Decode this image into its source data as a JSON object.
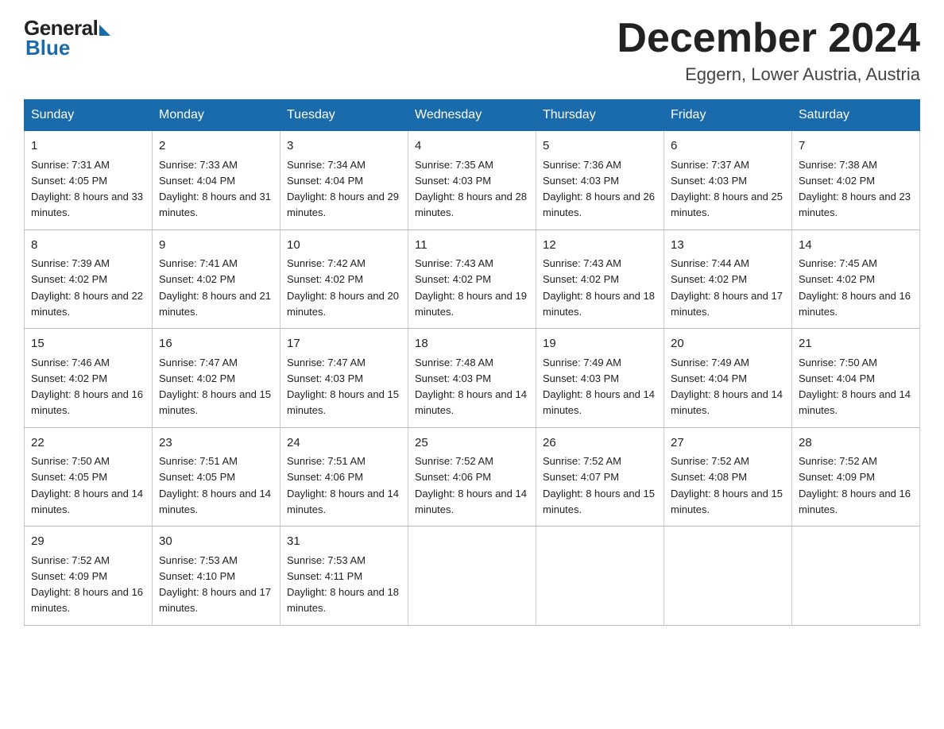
{
  "header": {
    "logo_general": "General",
    "logo_blue": "Blue",
    "month_title": "December 2024",
    "location": "Eggern, Lower Austria, Austria"
  },
  "weekdays": [
    "Sunday",
    "Monday",
    "Tuesday",
    "Wednesday",
    "Thursday",
    "Friday",
    "Saturday"
  ],
  "weeks": [
    [
      {
        "day": "1",
        "sunrise": "7:31 AM",
        "sunset": "4:05 PM",
        "daylight": "8 hours and 33 minutes."
      },
      {
        "day": "2",
        "sunrise": "7:33 AM",
        "sunset": "4:04 PM",
        "daylight": "8 hours and 31 minutes."
      },
      {
        "day": "3",
        "sunrise": "7:34 AM",
        "sunset": "4:04 PM",
        "daylight": "8 hours and 29 minutes."
      },
      {
        "day": "4",
        "sunrise": "7:35 AM",
        "sunset": "4:03 PM",
        "daylight": "8 hours and 28 minutes."
      },
      {
        "day": "5",
        "sunrise": "7:36 AM",
        "sunset": "4:03 PM",
        "daylight": "8 hours and 26 minutes."
      },
      {
        "day": "6",
        "sunrise": "7:37 AM",
        "sunset": "4:03 PM",
        "daylight": "8 hours and 25 minutes."
      },
      {
        "day": "7",
        "sunrise": "7:38 AM",
        "sunset": "4:02 PM",
        "daylight": "8 hours and 23 minutes."
      }
    ],
    [
      {
        "day": "8",
        "sunrise": "7:39 AM",
        "sunset": "4:02 PM",
        "daylight": "8 hours and 22 minutes."
      },
      {
        "day": "9",
        "sunrise": "7:41 AM",
        "sunset": "4:02 PM",
        "daylight": "8 hours and 21 minutes."
      },
      {
        "day": "10",
        "sunrise": "7:42 AM",
        "sunset": "4:02 PM",
        "daylight": "8 hours and 20 minutes."
      },
      {
        "day": "11",
        "sunrise": "7:43 AM",
        "sunset": "4:02 PM",
        "daylight": "8 hours and 19 minutes."
      },
      {
        "day": "12",
        "sunrise": "7:43 AM",
        "sunset": "4:02 PM",
        "daylight": "8 hours and 18 minutes."
      },
      {
        "day": "13",
        "sunrise": "7:44 AM",
        "sunset": "4:02 PM",
        "daylight": "8 hours and 17 minutes."
      },
      {
        "day": "14",
        "sunrise": "7:45 AM",
        "sunset": "4:02 PM",
        "daylight": "8 hours and 16 minutes."
      }
    ],
    [
      {
        "day": "15",
        "sunrise": "7:46 AM",
        "sunset": "4:02 PM",
        "daylight": "8 hours and 16 minutes."
      },
      {
        "day": "16",
        "sunrise": "7:47 AM",
        "sunset": "4:02 PM",
        "daylight": "8 hours and 15 minutes."
      },
      {
        "day": "17",
        "sunrise": "7:47 AM",
        "sunset": "4:03 PM",
        "daylight": "8 hours and 15 minutes."
      },
      {
        "day": "18",
        "sunrise": "7:48 AM",
        "sunset": "4:03 PM",
        "daylight": "8 hours and 14 minutes."
      },
      {
        "day": "19",
        "sunrise": "7:49 AM",
        "sunset": "4:03 PM",
        "daylight": "8 hours and 14 minutes."
      },
      {
        "day": "20",
        "sunrise": "7:49 AM",
        "sunset": "4:04 PM",
        "daylight": "8 hours and 14 minutes."
      },
      {
        "day": "21",
        "sunrise": "7:50 AM",
        "sunset": "4:04 PM",
        "daylight": "8 hours and 14 minutes."
      }
    ],
    [
      {
        "day": "22",
        "sunrise": "7:50 AM",
        "sunset": "4:05 PM",
        "daylight": "8 hours and 14 minutes."
      },
      {
        "day": "23",
        "sunrise": "7:51 AM",
        "sunset": "4:05 PM",
        "daylight": "8 hours and 14 minutes."
      },
      {
        "day": "24",
        "sunrise": "7:51 AM",
        "sunset": "4:06 PM",
        "daylight": "8 hours and 14 minutes."
      },
      {
        "day": "25",
        "sunrise": "7:52 AM",
        "sunset": "4:06 PM",
        "daylight": "8 hours and 14 minutes."
      },
      {
        "day": "26",
        "sunrise": "7:52 AM",
        "sunset": "4:07 PM",
        "daylight": "8 hours and 15 minutes."
      },
      {
        "day": "27",
        "sunrise": "7:52 AM",
        "sunset": "4:08 PM",
        "daylight": "8 hours and 15 minutes."
      },
      {
        "day": "28",
        "sunrise": "7:52 AM",
        "sunset": "4:09 PM",
        "daylight": "8 hours and 16 minutes."
      }
    ],
    [
      {
        "day": "29",
        "sunrise": "7:52 AM",
        "sunset": "4:09 PM",
        "daylight": "8 hours and 16 minutes."
      },
      {
        "day": "30",
        "sunrise": "7:53 AM",
        "sunset": "4:10 PM",
        "daylight": "8 hours and 17 minutes."
      },
      {
        "day": "31",
        "sunrise": "7:53 AM",
        "sunset": "4:11 PM",
        "daylight": "8 hours and 18 minutes."
      },
      null,
      null,
      null,
      null
    ]
  ]
}
